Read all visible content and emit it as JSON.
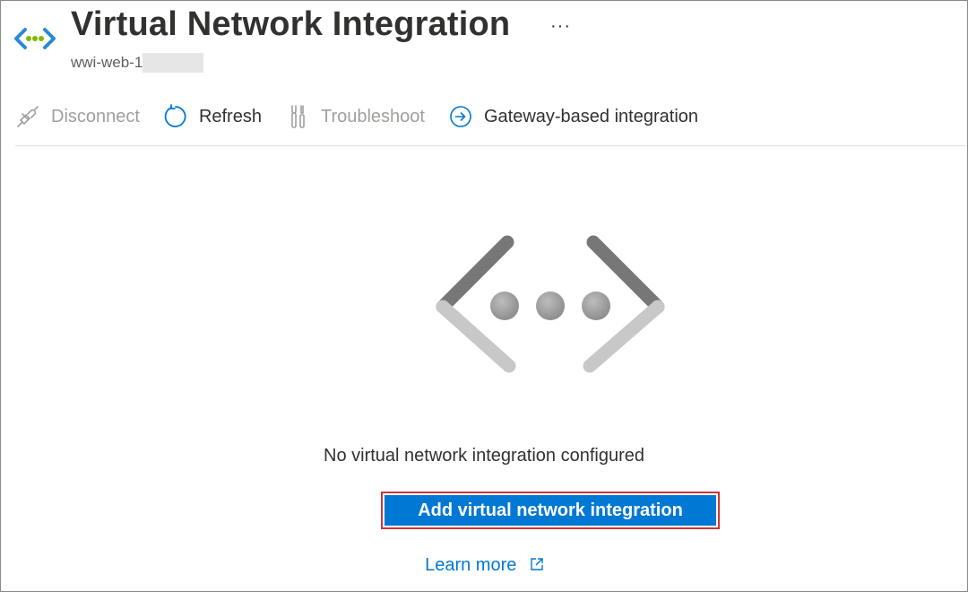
{
  "header": {
    "title": "Virtual Network Integration",
    "resource_name": "wwi-web-1",
    "more_label": "···",
    "icon": "virtual-network-icon"
  },
  "toolbar": {
    "items": [
      {
        "label": "Disconnect",
        "icon": "plug-icon",
        "enabled": false
      },
      {
        "label": "Refresh",
        "icon": "refresh-icon",
        "enabled": true
      },
      {
        "label": "Troubleshoot",
        "icon": "wrench-icon",
        "enabled": false
      },
      {
        "label": "Gateway-based integration",
        "icon": "arrow-circle-icon",
        "enabled": true
      }
    ]
  },
  "empty_state": {
    "message": "No virtual network integration configured",
    "primary_button": "Add virtual network integration",
    "learn_more": "Learn more"
  },
  "colors": {
    "accent": "#0078d4",
    "highlight_border": "#d13438",
    "disabled_text": "#a19f9d"
  }
}
